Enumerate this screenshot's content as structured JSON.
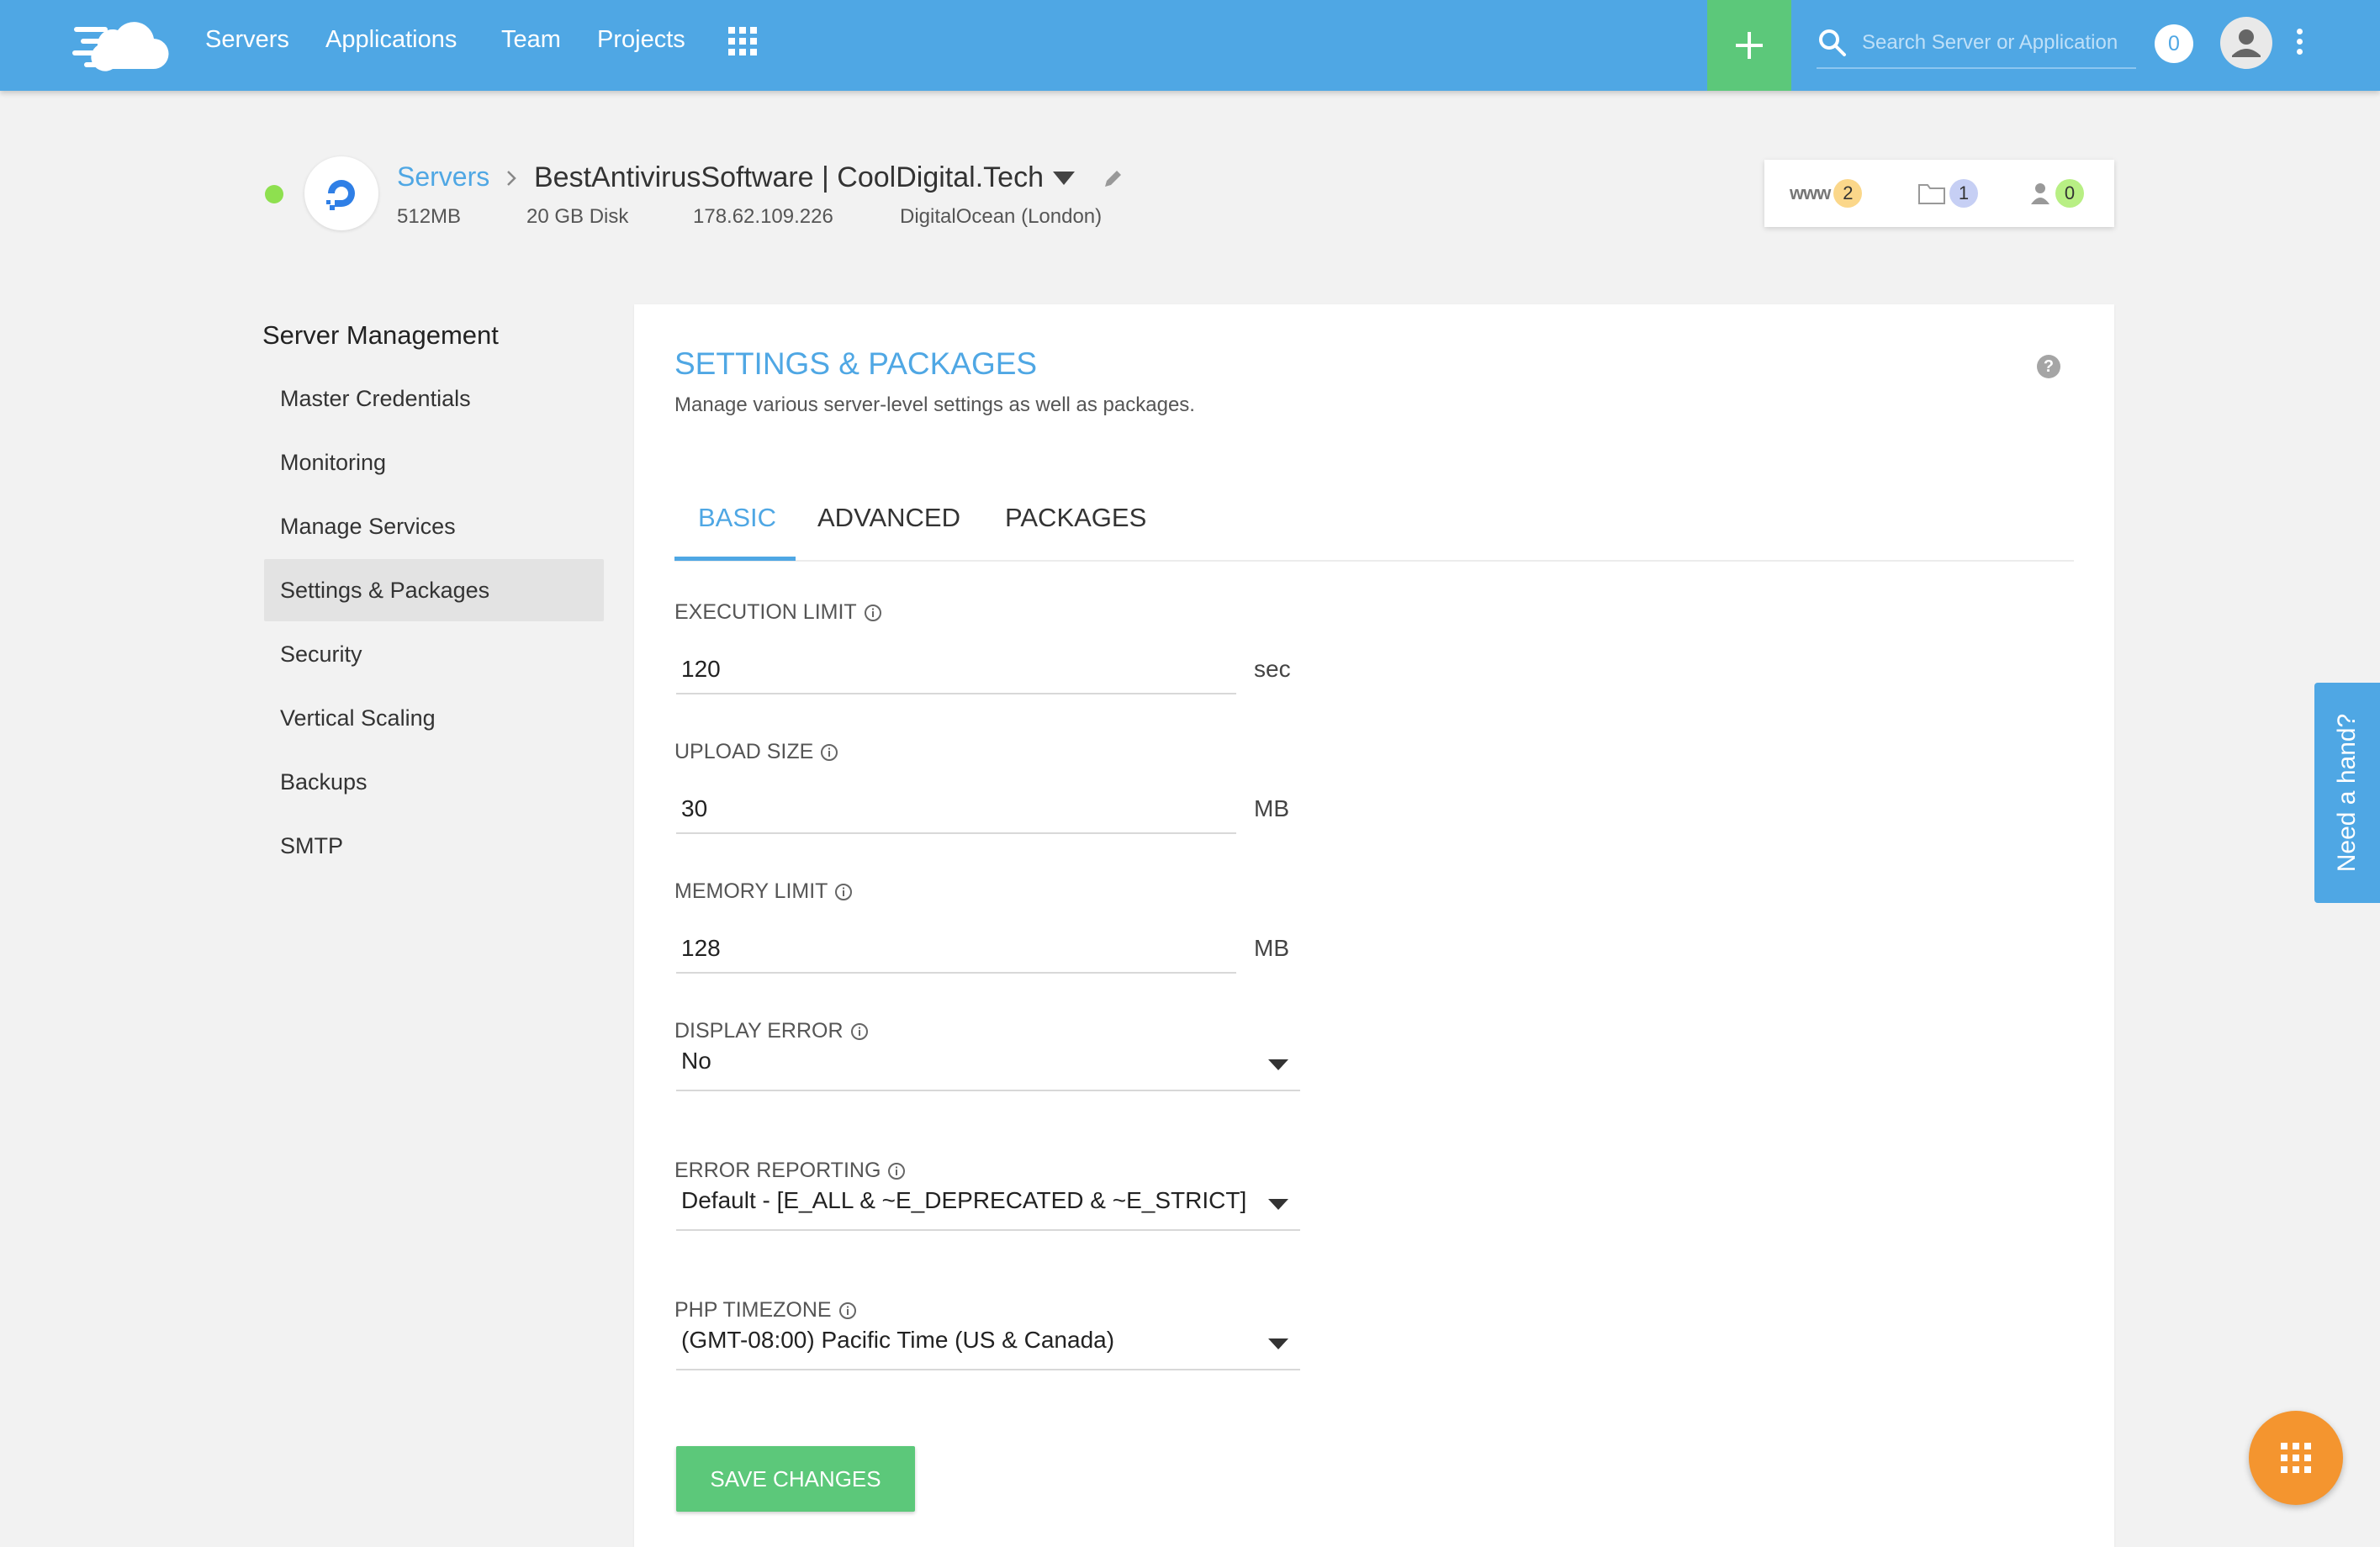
{
  "topbar": {
    "nav": [
      "Servers",
      "Applications",
      "Team",
      "Projects"
    ],
    "search_placeholder": "Search Server or Application",
    "notification_count": "0"
  },
  "server": {
    "breadcrumb_root": "Servers",
    "name": "BestAntivirusSoftware | CoolDigital.Tech",
    "memory": "512MB",
    "disk": "20 GB Disk",
    "ip": "178.62.109.226",
    "provider": "DigitalOcean (London)",
    "stats": {
      "www_label": "www",
      "apps": "2",
      "folders": "1",
      "users": "0"
    }
  },
  "sidebar": {
    "title": "Server Management",
    "items": [
      {
        "label": "Master Credentials"
      },
      {
        "label": "Monitoring"
      },
      {
        "label": "Manage Services"
      },
      {
        "label": "Settings & Packages"
      },
      {
        "label": "Security"
      },
      {
        "label": "Vertical Scaling"
      },
      {
        "label": "Backups"
      },
      {
        "label": "SMTP"
      }
    ],
    "active_item": "Settings & Packages"
  },
  "panel": {
    "title": "SETTINGS & PACKAGES",
    "subtitle": "Manage various server-level settings as well as packages.",
    "tabs": [
      "BASIC",
      "ADVANCED",
      "PACKAGES"
    ],
    "active_tab": "BASIC",
    "fields": {
      "execution_limit": {
        "label": "EXECUTION LIMIT",
        "value": "120",
        "unit": "sec"
      },
      "upload_size": {
        "label": "UPLOAD SIZE",
        "value": "30",
        "unit": "MB"
      },
      "memory_limit": {
        "label": "MEMORY LIMIT",
        "value": "128",
        "unit": "MB"
      },
      "display_error": {
        "label": "DISPLAY ERROR",
        "value": "No"
      },
      "error_reporting": {
        "label": "ERROR REPORTING",
        "value": "Default - [E_ALL & ~E_DEPRECATED & ~E_STRICT]"
      },
      "php_timezone": {
        "label": "PHP TIMEZONE",
        "value": "(GMT-08:00) Pacific Time (US & Canada)"
      }
    },
    "save_label": "SAVE CHANGES"
  },
  "help_tab": "Need a hand?",
  "colors": {
    "primary": "#4fa7e4",
    "success": "#5cc87a",
    "fab": "#f4952f",
    "status_online": "#8ee04f",
    "badge_apps": "#fbd78a",
    "badge_folders": "#c6cff4",
    "badge_users": "#b8ef84"
  }
}
